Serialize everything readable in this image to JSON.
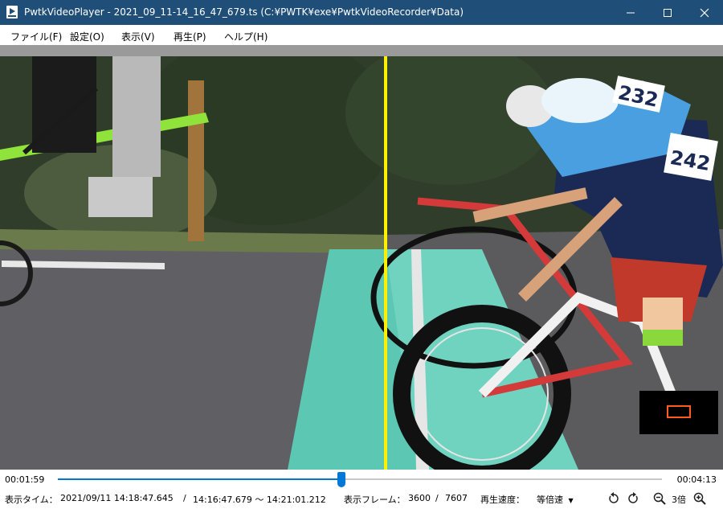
{
  "window": {
    "title": "PwtkVideoPlayer - 2021_09_11-14_16_47_679.ts (C:¥PWTK¥exe¥PwtkVideoRecorder¥Data)",
    "icon": "app-icon",
    "titlebar_color": "#1f4e79",
    "controls": [
      "minimize-icon",
      "maximize-icon",
      "close-icon"
    ]
  },
  "menu": {
    "file": "ファイル(F)",
    "settings": "設定(O)",
    "view": "表示(V)",
    "play": "再生(P)",
    "help": "ヘルプ(H)"
  },
  "video": {
    "finish_line_color": "#ffef00",
    "minimap_viewport_color": "#ff5a1f",
    "rider_numbers": [
      "232",
      "242"
    ]
  },
  "seek": {
    "current_time": "00:01:59",
    "total_time": "00:04:13",
    "progress": 0.47,
    "accent_color": "#0078d7"
  },
  "status": {
    "display_time_label": "表示タイム：",
    "display_time_value": "2021/09/11 14:18:47.645",
    "separator": "/",
    "range_value": "14:16:47.679 ～ 14:21:01.212",
    "frame_label": "表示フレーム：",
    "frame_current": "3600",
    "frame_separator": "/",
    "frame_total": "7607",
    "speed_label": "再生速度：",
    "speed_value": "等倍速",
    "speed_dropdown_icon": "chevron-down-icon",
    "zoom_value": "3倍"
  }
}
